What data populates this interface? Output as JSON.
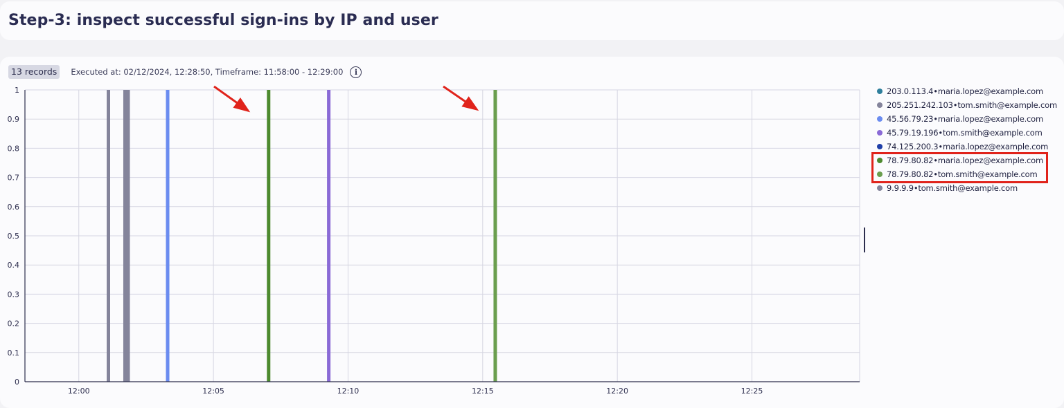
{
  "page": {
    "title": "Step-3: inspect successful sign-ins by IP and user"
  },
  "meta": {
    "records": "13 records",
    "executed": "Executed at: 02/12/2024, 12:28:50, Timeframe: 11:58:00 - 12:29:00",
    "info_icon": "info-icon"
  },
  "colors": {
    "highlight": "#e0231b",
    "grid": "#d6d6e2",
    "axis": "#2c2d4d"
  },
  "chart_data": {
    "type": "bar",
    "title": "",
    "xlabel": "",
    "ylabel": "",
    "xlim": [
      "11:58:00",
      "12:29:00"
    ],
    "ylim": [
      0,
      1
    ],
    "x_ticks": [
      "12:00",
      "12:05",
      "12:10",
      "12:15",
      "12:20",
      "12:25"
    ],
    "y_ticks": [
      "0",
      "0.1",
      "0.2",
      "0.3",
      "0.4",
      "0.5",
      "0.6",
      "0.7",
      "0.8",
      "0.9",
      "1"
    ],
    "grid": true,
    "legend_position": "right",
    "series": [
      {
        "name": "203.0.113.4•maria.lopez@example.com",
        "color": "#2f7f9c",
        "points": []
      },
      {
        "name": "205.251.242.103•tom.smith@example.com",
        "color": "#84849b",
        "points": [
          {
            "x": "12:01:06",
            "y": 1
          },
          {
            "x": "12:01:43",
            "y": 1
          },
          {
            "x": "12:01:50",
            "y": 1
          }
        ]
      },
      {
        "name": "45.56.79.23•maria.lopez@example.com",
        "color": "#6b8cf0",
        "points": [
          {
            "x": "12:03:18",
            "y": 1
          }
        ]
      },
      {
        "name": "45.79.19.196•tom.smith@example.com",
        "color": "#8a6ad6",
        "points": [
          {
            "x": "12:09:17",
            "y": 1
          }
        ]
      },
      {
        "name": "74.125.200.3•maria.lopez@example.com",
        "color": "#1f3fa8",
        "points": []
      },
      {
        "name": "78.79.80.82•maria.lopez@example.com",
        "color": "#4d8a2f",
        "points": [
          {
            "x": "12:07:03",
            "y": 1
          }
        ]
      },
      {
        "name": "78.79.80.82•tom.smith@example.com",
        "color": "#6a9e4e",
        "points": [
          {
            "x": "12:15:28",
            "y": 1
          }
        ]
      },
      {
        "name": "9.9.9.9•tom.smith@example.com",
        "color": "#84849b",
        "points": []
      }
    ]
  }
}
